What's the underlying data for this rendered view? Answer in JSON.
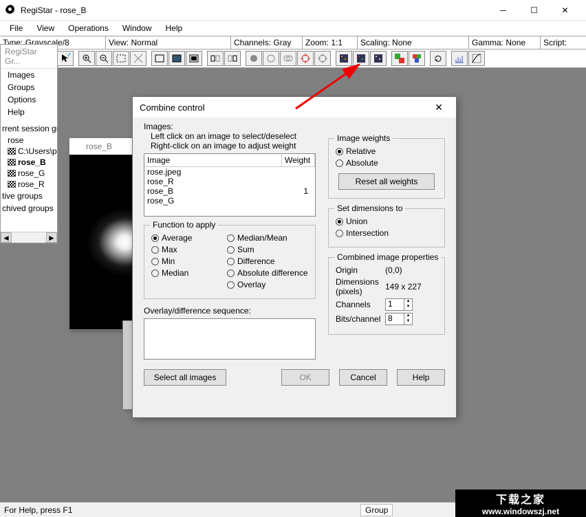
{
  "app": {
    "title": "RegiStar - rose_B"
  },
  "menu": {
    "file": "File",
    "view": "View",
    "operations": "Operations",
    "window": "Window",
    "help": "Help"
  },
  "info": {
    "type_label": "Type:",
    "type_val": "Grayscale/8",
    "view_label": "View:",
    "view_val": "Normal",
    "channels_label": "Channels:",
    "channels_val": "Gray",
    "zoom_label": "Zoom:",
    "zoom_val": "1:1",
    "scaling_label": "Scaling:",
    "scaling_val": "None",
    "gamma_label": "Gamma:",
    "gamma_val": "None",
    "script_label": "Script:"
  },
  "sidepanel": {
    "title": "RegiStar Gr...",
    "items": [
      "Images",
      "Groups",
      "Options",
      "Help"
    ],
    "section_current": "rrent session group",
    "group": "rose",
    "group_path": "C:\\Users\\pc",
    "files": [
      "rose_B",
      "rose_G",
      "rose_R"
    ],
    "section_active": "tive groups",
    "section_archived": "chived groups"
  },
  "imgwin": {
    "title": "rose_B"
  },
  "dialog": {
    "title": "Combine control",
    "images_label": "Images:",
    "hint1": "Left click on an image to select/deselect",
    "hint2": "Right-click on an image to adjust weight",
    "col_image": "Image",
    "col_weight": "Weight",
    "rows": [
      {
        "name": "rose.jpeg",
        "weight": ""
      },
      {
        "name": "rose_R",
        "weight": ""
      },
      {
        "name": "rose_B",
        "weight": "1"
      },
      {
        "name": "rose_G",
        "weight": ""
      }
    ],
    "weights_group": "Image weights",
    "w_relative": "Relative",
    "w_absolute": "Absolute",
    "reset_weights": "Reset all weights",
    "func_group": "Function to apply",
    "f_average": "Average",
    "f_max": "Max",
    "f_min": "Min",
    "f_median": "Median",
    "f_medianmean": "Median/Mean",
    "f_sum": "Sum",
    "f_difference": "Difference",
    "f_absdiff": "Absolute difference",
    "f_overlay": "Overlay",
    "dims_group": "Set dimensions to",
    "d_union": "Union",
    "d_intersection": "Intersection",
    "props_group": "Combined image properties",
    "p_origin": "Origin",
    "p_origin_v": "(0,0)",
    "p_dims": "Dimensions (pixels)",
    "p_dims_v": "149 x 227",
    "p_channels": "Channels",
    "p_channels_v": "1",
    "p_bits": "Bits/channel",
    "p_bits_v": "8",
    "seq_label": "Overlay/difference sequence:",
    "btn_selectall": "Select all images",
    "btn_ok": "OK",
    "btn_cancel": "Cancel",
    "btn_help": "Help"
  },
  "status": {
    "help": "For Help, press F1",
    "group": "Group"
  },
  "watermark": {
    "big": "下载之家",
    "url": "www.windowszj.net"
  }
}
